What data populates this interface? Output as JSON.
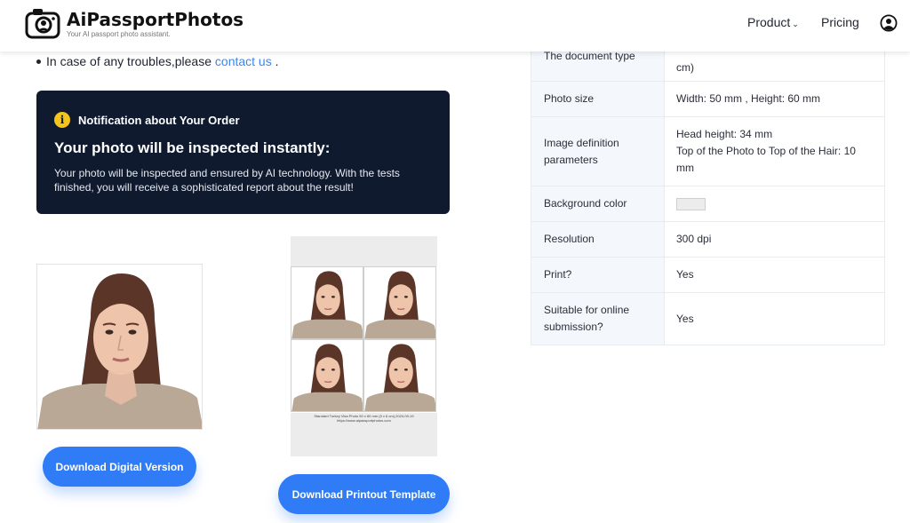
{
  "header": {
    "logo_title": "AiPassportPhotos",
    "logo_subtitle": "Your AI passport photo assistant.",
    "nav": {
      "product": "Product",
      "pricing": "Pricing"
    },
    "icons": {
      "logo": "camera-passport-icon",
      "caret": "chevron-down-icon",
      "user": "user-account-icon"
    }
  },
  "bullet": {
    "text": "In case of any troubles,please ",
    "link": "contact us",
    "suffix": " ."
  },
  "notice": {
    "title": "Notification about Your Order",
    "heading": "Your photo will be inspected instantly:",
    "body": "Your photo will be inspected and ensured by AI technology. With the tests finished, you will receive a sophisticated report about the result!",
    "icon": "info-icon",
    "colors": {
      "background": "#0f1a2e",
      "icon": "#f3c41a"
    }
  },
  "sheet": {
    "caption_line1": "Standard Turkey Visa Photo 50 x 60 mm (5 x 6 cm),2024-09-19",
    "caption_line2": "https://www.aipassportphotos.com"
  },
  "buttons": {
    "download_digital": "Download Digital Version",
    "download_print": "Download Printout Template",
    "color": "#2f7cf6"
  },
  "spec": {
    "rows": [
      {
        "key": "The document type",
        "value": "cm)"
      },
      {
        "key": "Photo size",
        "value": "Width: 50 mm , Height: 60 mm"
      },
      {
        "key": "Image definition parameters",
        "value": "Head height: 34 mm",
        "value2": "Top of the Photo to Top of the Hair: 10 mm"
      },
      {
        "key": "Background color",
        "value": "",
        "swatch": "#ececec"
      },
      {
        "key": "Resolution",
        "value": "300 dpi"
      },
      {
        "key": "Print?",
        "value": "Yes"
      },
      {
        "key": "Suitable for online submission?",
        "value": "Yes"
      }
    ]
  }
}
